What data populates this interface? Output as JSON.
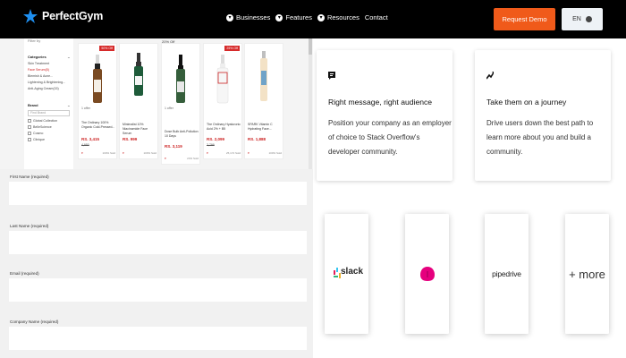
{
  "brand": {
    "name": "PerfectGym",
    "accent": "#f05a1a"
  },
  "nav": {
    "items": [
      {
        "label": "Businesses",
        "icon": "chevron-down-icon"
      },
      {
        "label": "Features",
        "icon": "chevron-down-icon"
      },
      {
        "label": "Resources",
        "icon": "chevron-down-icon"
      },
      {
        "label": "Contact"
      }
    ],
    "demo_label": "Request Demo",
    "lang_label": "EN"
  },
  "shop": {
    "search": "Filter by",
    "filters": {
      "category_heading": "Categories",
      "category_links": [
        "Skin Treatment",
        "Face Serum(5)",
        "Blemish & Acne...",
        "Lightening & Brightening...",
        "Anti-Aging Cream(15)"
      ],
      "brand_heading": "Brand",
      "brand_search": "Find Brand",
      "brands": [
        "Global Collection",
        "BelleScience",
        "Cosmo",
        "Clinique"
      ]
    },
    "products": [
      {
        "badge": "50% Off",
        "name": "The Ordinary 100% Organic Cold-Pressed...",
        "price": "RS. 3,415",
        "old": "4,950",
        "count": "1 offer",
        "tag": "100% Sold"
      },
      {
        "name": "Minimalist 10% Niacinamide Face Serum",
        "price": "RS. 999",
        "count": "",
        "tag": "100% Sold"
      },
      {
        "off": "20% Off",
        "name": "Dose Bulb Anti-Pollution 10 Days",
        "price": "RS. 3,119",
        "old": "3,899",
        "count": "1 offer",
        "tag": "24% Sold"
      },
      {
        "badge": "25% Off",
        "name": "The Ordinary Hyaluronic Acid 2% + B5",
        "price": "RS. 2,099",
        "old": "2,799",
        "count": "",
        "tag": "25,172 Sold"
      },
      {
        "name": "SPARK Vitamin C Hydrating Face...",
        "price": "RS. 1,888",
        "count": "",
        "tag": "100% Sold"
      }
    ]
  },
  "form": {
    "fields": [
      {
        "label": "First Name (required)"
      },
      {
        "label": "Last Name (required)"
      },
      {
        "label": "Email (required)"
      },
      {
        "label": "Company Name (required)"
      }
    ]
  },
  "features": [
    {
      "icon": "message-icon",
      "title": "Right message, right audience",
      "body": "Position your company as an employer of choice to Stack Overflow's developer community."
    },
    {
      "icon": "path-icon",
      "title": "Take them on a journey",
      "body": "Drive users down the best path to learn more about you and build a community."
    }
  ],
  "integrations": {
    "items": [
      {
        "name": "slack",
        "label": "slack"
      },
      {
        "name": "pink-app",
        "label": ""
      },
      {
        "name": "pipedrive",
        "label": "pipedrive"
      },
      {
        "name": "more",
        "label": "+ more"
      }
    ]
  }
}
